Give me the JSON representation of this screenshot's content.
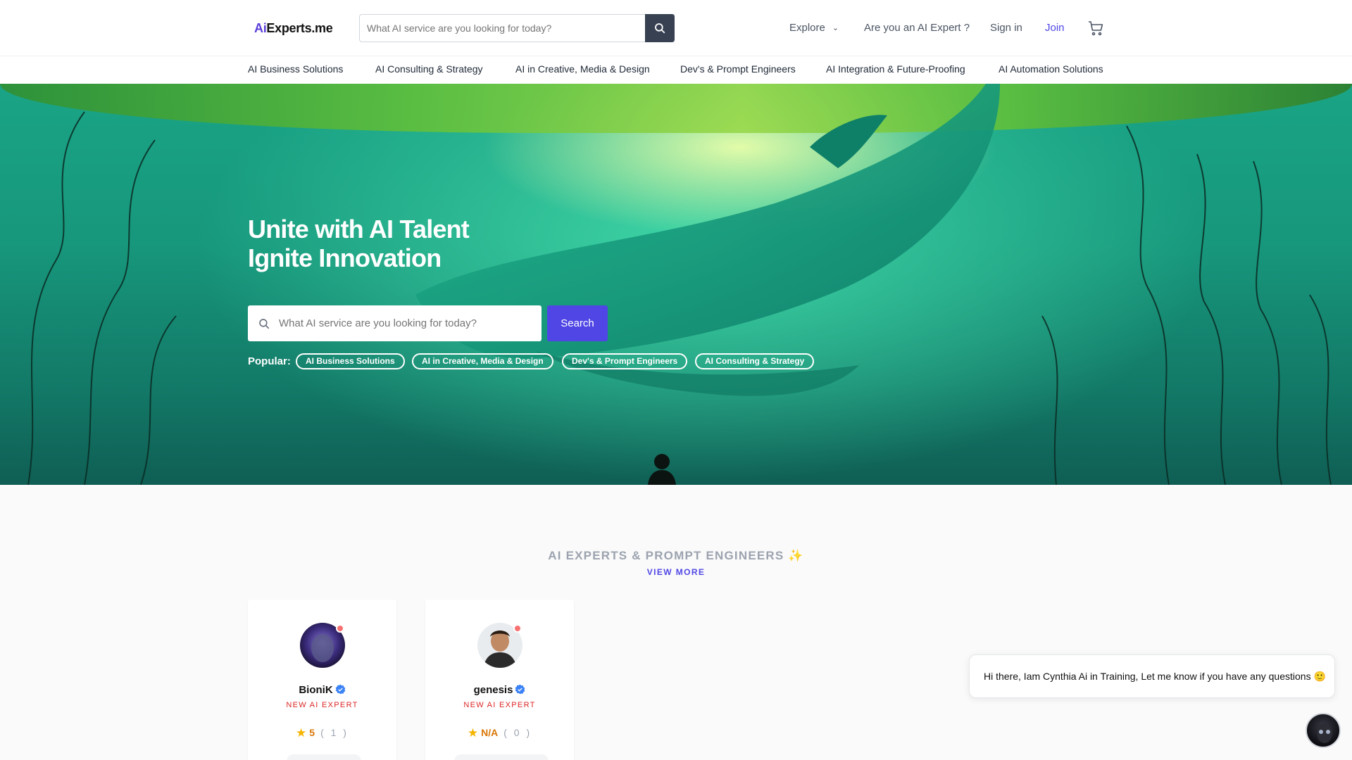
{
  "header": {
    "logo_ai": "Ai",
    "logo_rest": "Experts.me",
    "search_placeholder": "What AI service are you looking for today?",
    "explore": "Explore",
    "are_you_expert": "Are you an AI Expert ?",
    "sign_in": "Sign in",
    "join": "Join"
  },
  "categories": [
    "AI Business Solutions",
    "AI Consulting & Strategy",
    "AI in Creative, Media & Design",
    "Dev's & Prompt Engineers",
    "AI Integration & Future-Proofing",
    "AI Automation Solutions"
  ],
  "hero": {
    "title_line1": "Unite with AI Talent",
    "title_line2": "Ignite Innovation",
    "search_placeholder": "What AI service are you looking for today?",
    "search_button": "Search",
    "popular_label": "Popular:",
    "popular": [
      "AI Business Solutions",
      "AI in Creative, Media & Design",
      "Dev's & Prompt Engineers",
      "AI Consulting & Strategy"
    ]
  },
  "experts_section": {
    "title": "AI EXPERTS & PROMPT ENGINEERS",
    "view_more": "VIEW MORE",
    "experts": [
      {
        "name": "BioniK",
        "tag": "NEW AI EXPERT",
        "rating": "5",
        "count": "( 1 )"
      },
      {
        "name": "genesis",
        "tag": "NEW AI EXPERT",
        "rating": "N/A",
        "count": "( 0 )"
      }
    ]
  },
  "chat": {
    "message": "Hi there, Iam Cynthia Ai in Training, Let me know if you have any questions 🙂"
  },
  "colors": {
    "brand": "#4f46e5",
    "hero_teal": "#17977c",
    "tag_red": "#dc2626",
    "star": "#f5b400"
  }
}
